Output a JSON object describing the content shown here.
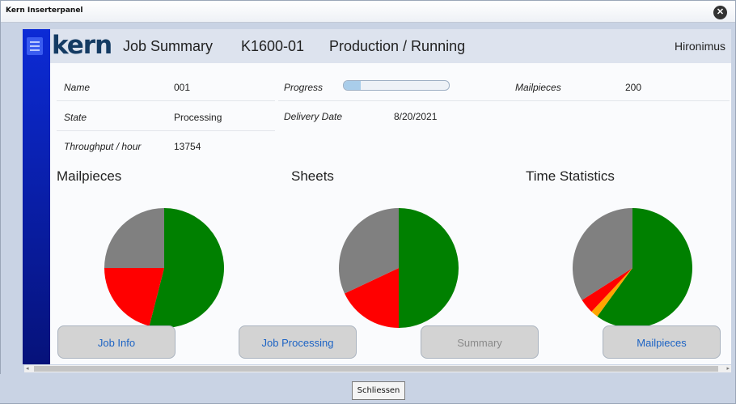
{
  "window": {
    "title": "Kern Inserterpanel",
    "close_icon": "close-icon"
  },
  "header": {
    "logo": "kern",
    "page": "Job Summary",
    "job_id": "K1600-01",
    "status": "Production / Running",
    "user": "Hironimus"
  },
  "fields": {
    "name_label": "Name",
    "name_value": "001",
    "state_label": "State",
    "state_value": "Processing",
    "throughput_label": "Throughput / hour",
    "throughput_value": "13754",
    "progress_label": "Progress",
    "progress_fraction": 0.16,
    "delivery_label": "Delivery Date",
    "delivery_value": "8/20/2021",
    "mailpieces_label": "Mailpieces",
    "mailpieces_value": "200"
  },
  "sections": {
    "mailpieces": "Mailpieces",
    "sheets": "Sheets",
    "time_statistics": "Time Statistics"
  },
  "charts": {
    "colors": {
      "green": "#008000",
      "red": "#ff0000",
      "gray": "#808080",
      "orange": "#ffa500"
    },
    "mailpieces": [
      {
        "color": "green",
        "value": 54
      },
      {
        "color": "red",
        "value": 21
      },
      {
        "color": "gray",
        "value": 25
      }
    ],
    "sheets": [
      {
        "color": "green",
        "value": 50
      },
      {
        "color": "red",
        "value": 18
      },
      {
        "color": "gray",
        "value": 32
      }
    ],
    "time_statistics": [
      {
        "color": "green",
        "value": 60
      },
      {
        "color": "orange",
        "value": 2
      },
      {
        "color": "red",
        "value": 4
      },
      {
        "color": "gray",
        "value": 34
      }
    ]
  },
  "nav": {
    "job_info": "Job Info",
    "job_processing": "Job Processing",
    "summary": "Summary",
    "mailpieces": "Mailpieces"
  },
  "footer": {
    "close_label": "Schliessen"
  }
}
